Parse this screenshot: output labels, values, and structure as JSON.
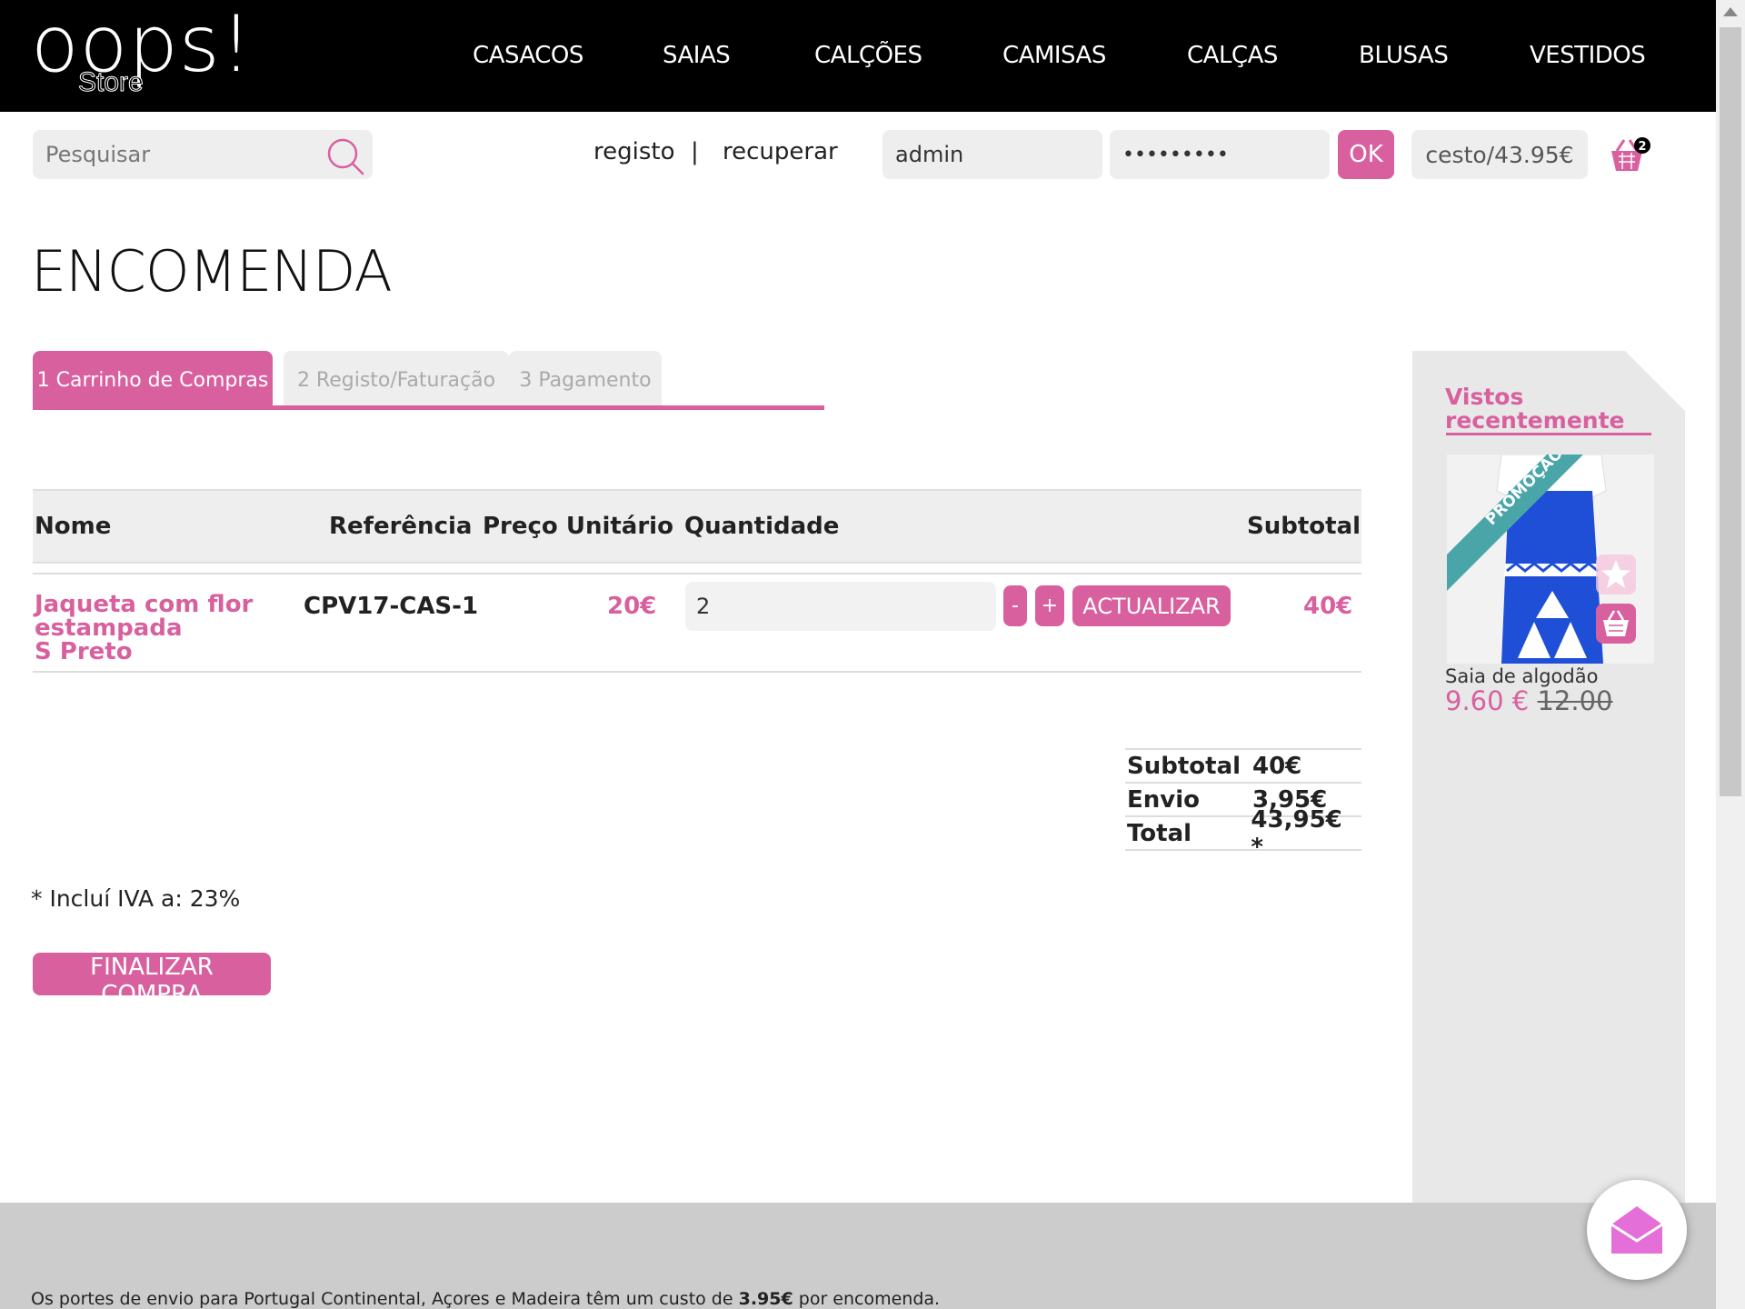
{
  "brand": {
    "logo": "oops!",
    "sub": "Store"
  },
  "nav": [
    "CASACOS",
    "SAIAS",
    "CALÇÕES",
    "CAMISAS",
    "CALÇAS",
    "BLUSAS",
    "VESTIDOS"
  ],
  "topbar": {
    "search_placeholder": "Pesquisar",
    "register": "registo",
    "separator": "|",
    "recover": "recuperar",
    "username": "admin",
    "password": "•••••••••",
    "ok": "OK",
    "basket": "cesto/43.95€",
    "basket_count": "2"
  },
  "page_title": "ENCOMENDA",
  "steps": [
    "1 Carrinho de Compras",
    "2 Registo/Faturação",
    "3 Pagamento"
  ],
  "table": {
    "headers": [
      "Nome",
      "Referência",
      "Preço Unitário",
      "Quantidade",
      "Subtotal"
    ],
    "rows": [
      {
        "name_line1": "Jaqueta com flor",
        "name_line2": "estampada",
        "name_line3": "S Preto",
        "reference": "CPV17-CAS-1",
        "unit_price": "20€",
        "quantity": "2",
        "minus": "-",
        "plus": "+",
        "update": "ACTUALIZAR",
        "subtotal": "40€"
      }
    ]
  },
  "totals": [
    {
      "label": "Subtotal",
      "value": "40€"
    },
    {
      "label": "Envio",
      "value": "3,95€"
    },
    {
      "label": "Total",
      "value": "43,95€ *"
    }
  ],
  "vat_note": "* Incluí IVA a: 23%",
  "finalize": "FINALIZAR COMPRA",
  "sidebar": {
    "title_line1": "Vistos",
    "title_line2": "recentemente",
    "badge": "PROMOÇÃO",
    "product_name": "Saia de algodão",
    "price": "9.60 €",
    "old_price": "12.00"
  },
  "footer": {
    "text_before": "Os portes de envio para Portugal Continental, Açores e Madeira têm um custo de ",
    "text_bold": "3.95€",
    "text_after": " por encomenda."
  },
  "colors": {
    "accent": "#d9609f",
    "header": "#000000",
    "panel": "#eeeeee",
    "teal": "#4aa5a8",
    "blue": "#1e4fd6"
  },
  "icons": [
    "search-icon",
    "basket-icon",
    "star-icon",
    "cart-icon",
    "envelope-icon"
  ]
}
